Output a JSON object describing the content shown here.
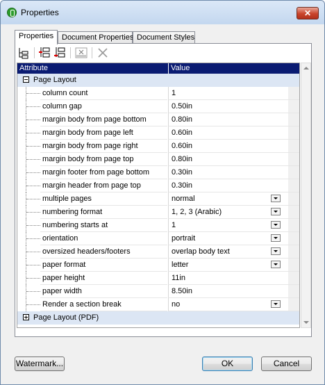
{
  "window": {
    "title": "Properties",
    "close_label": "✕"
  },
  "tabs": [
    {
      "label": "Properties",
      "active": true
    },
    {
      "label": "Document Properties",
      "active": false
    },
    {
      "label": "Document Styles",
      "active": false
    }
  ],
  "toolbar": {
    "buttons": [
      "tree-structure-icon",
      "insert-property-icon",
      "append-property-icon",
      "xpath-icon",
      "delete-icon"
    ]
  },
  "grid": {
    "header": {
      "attribute": "Attribute",
      "value": "Value"
    },
    "groups": [
      {
        "label": "Page Layout",
        "expanded": true,
        "rows": [
          {
            "attr": "column count",
            "value": "1",
            "dropdown": false
          },
          {
            "attr": "column gap",
            "value": "0.50in",
            "dropdown": false
          },
          {
            "attr": "margin body from page bottom",
            "value": "0.80in",
            "dropdown": false
          },
          {
            "attr": "margin body from page left",
            "value": "0.60in",
            "dropdown": false
          },
          {
            "attr": "margin body from page right",
            "value": "0.60in",
            "dropdown": false
          },
          {
            "attr": "margin body from page top",
            "value": "0.80in",
            "dropdown": false
          },
          {
            "attr": "margin footer from page bottom",
            "value": "0.30in",
            "dropdown": false
          },
          {
            "attr": "margin header from page top",
            "value": "0.30in",
            "dropdown": false
          },
          {
            "attr": "multiple pages",
            "value": "normal",
            "dropdown": true
          },
          {
            "attr": "numbering format",
            "value": "1, 2, 3 (Arabic)",
            "dropdown": true
          },
          {
            "attr": "numbering starts at",
            "value": "1",
            "dropdown": true
          },
          {
            "attr": "orientation",
            "value": "portrait",
            "dropdown": true
          },
          {
            "attr": "oversized headers/footers",
            "value": "overlap body text",
            "dropdown": true
          },
          {
            "attr": "paper format",
            "value": "letter",
            "dropdown": true
          },
          {
            "attr": "paper height",
            "value": "11in",
            "dropdown": false
          },
          {
            "attr": "paper width",
            "value": "8.50in",
            "dropdown": false
          },
          {
            "attr": "Render a section break",
            "value": "no",
            "dropdown": true
          }
        ]
      },
      {
        "label": "Page Layout (PDF)",
        "expanded": false,
        "rows": []
      }
    ]
  },
  "buttons": {
    "watermark": "Watermark...",
    "ok": "OK",
    "cancel": "Cancel"
  },
  "colors": {
    "header_bg": "#0a1b72",
    "group_bg": "#dce6f4"
  }
}
